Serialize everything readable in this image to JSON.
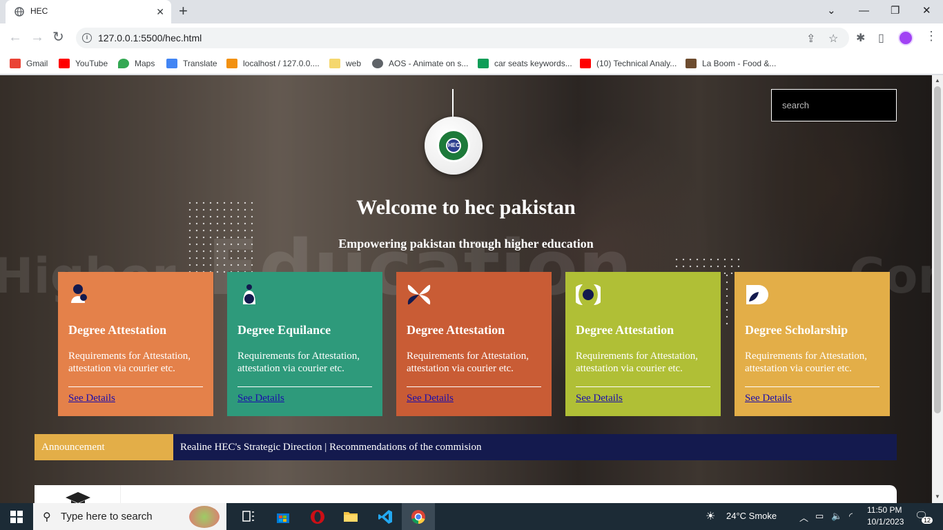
{
  "browser": {
    "tab_title": "HEC",
    "url": "127.0.0.1:5500/hec.html",
    "bookmarks": [
      {
        "label": "Gmail",
        "icon": "gmail-icon",
        "color": "#ea4335"
      },
      {
        "label": "YouTube",
        "icon": "youtube-icon",
        "color": "#ff0000"
      },
      {
        "label": "Maps",
        "icon": "maps-icon",
        "color": "#34a853"
      },
      {
        "label": "Translate",
        "icon": "translate-icon",
        "color": "#4285f4"
      },
      {
        "label": "localhost / 127.0.0....",
        "icon": "phpmyadmin-icon",
        "color": "#f29111"
      },
      {
        "label": "web",
        "icon": "folder-icon",
        "color": "#f5d76e"
      },
      {
        "label": "AOS - Animate on s...",
        "icon": "globe-icon",
        "color": "#5f6368"
      },
      {
        "label": "car seats keywords...",
        "icon": "sheets-icon",
        "color": "#0f9d58"
      },
      {
        "label": "(10) Technical Analy...",
        "icon": "youtube-icon",
        "color": "#ff0000"
      },
      {
        "label": "La Boom - Food &...",
        "icon": "site-icon",
        "color": "#6d4c2f"
      }
    ]
  },
  "page": {
    "search_placeholder": "search",
    "bg_words": [
      "Higher",
      "Education",
      "Comm"
    ],
    "title": "Welcome to hec pakistan",
    "subtitle": "Empowering pakistan through higher education",
    "logo_text": "HEC",
    "cards": [
      {
        "title": "Degree Attestation",
        "desc": "Requirements for Attestation, attestation via courier etc.",
        "link": "See Details",
        "color": "#e4814a"
      },
      {
        "title": "Degree Equilance",
        "desc": "Requirements for Attestation, attestation via courier etc.",
        "link": "See Details",
        "color": "#2e9a7b"
      },
      {
        "title": "Degree Attestation",
        "desc": "Requirements for Attestation, attestation via courier etc.",
        "link": "See Details",
        "color": "#c95c35"
      },
      {
        "title": "Degree Attestation",
        "desc": "Requirements for Attestation, attestation via courier etc.",
        "link": "See Details",
        "color": "#b0bf36"
      },
      {
        "title": "Degree Scholarship",
        "desc": "Requirements for Attestation, attestation via courier etc.",
        "link": "See Details",
        "color": "#e3ae48"
      }
    ],
    "announcement_label": "Announcement",
    "announcement_text": "Realine HEC's Strategic Direction | Recommendations of the commision"
  },
  "taskbar": {
    "search_placeholder": "Type here to search",
    "weather": "24°C  Smoke",
    "time": "11:50 PM",
    "date": "10/1/2023",
    "notifications": "12"
  }
}
